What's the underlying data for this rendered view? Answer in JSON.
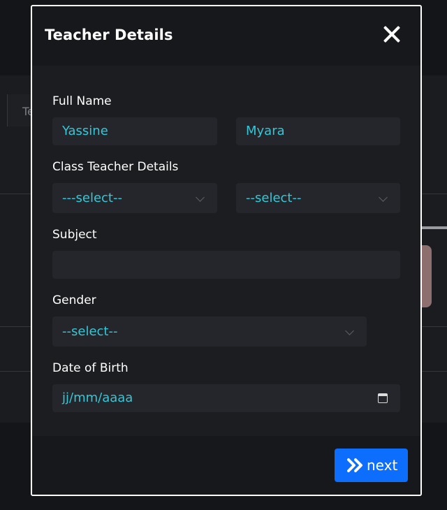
{
  "background": {
    "tab_label": "Te"
  },
  "modal": {
    "title": "Teacher Details",
    "close_icon": "close-icon"
  },
  "form": {
    "full_name_label": "Full Name",
    "first_name_value": "Yassine",
    "last_name_value": "Myara",
    "class_teacher_label": "Class Teacher Details",
    "class_select_1": "---select--",
    "class_select_2": "--select--",
    "subject_label": "Subject",
    "subject_value": "",
    "gender_label": "Gender",
    "gender_select": "--select--",
    "dob_label": "Date of Birth",
    "dob_placeholder": "jj/mm/aaaa"
  },
  "footer": {
    "next_label": "next"
  },
  "colors": {
    "accent": "#0d6efd",
    "value_text": "#35c7d6"
  }
}
